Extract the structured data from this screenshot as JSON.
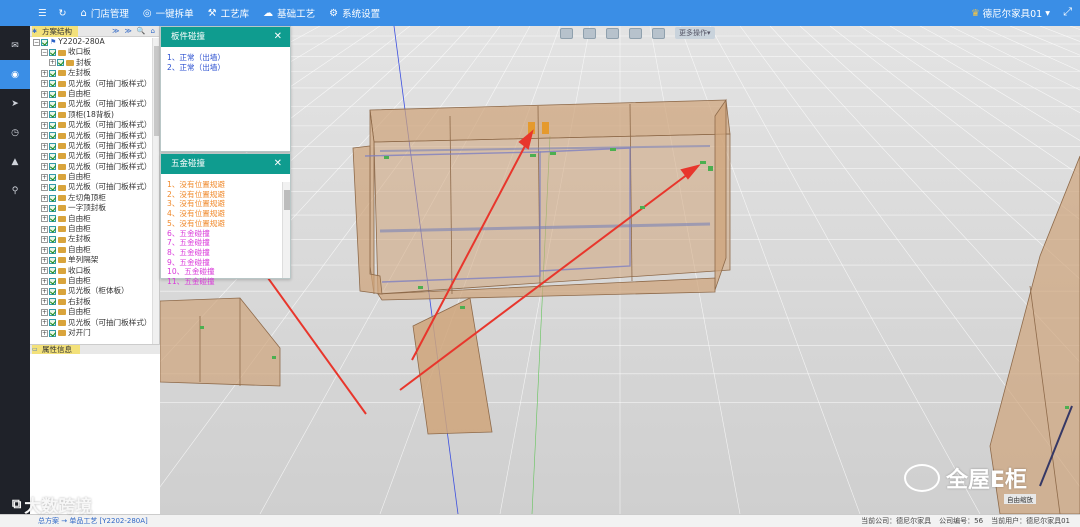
{
  "topbar": {
    "menu_icon": "menu-icon",
    "refresh_icon": "refresh-icon",
    "items": [
      {
        "label": "门店管理",
        "icon": "home-icon"
      },
      {
        "label": "一键拆单",
        "icon": "check-circle-icon"
      },
      {
        "label": "工艺库",
        "icon": "hammer-icon"
      },
      {
        "label": "基础工艺",
        "icon": "cloud-icon"
      },
      {
        "label": "系统设置",
        "icon": "gear-icon"
      }
    ],
    "brand": "德尼尔家具01",
    "brand_caret": "▾"
  },
  "rail": {
    "icons": [
      "mail-icon",
      "wifi-icon",
      "send-icon",
      "clock-icon",
      "hat-icon",
      "search-icon"
    ],
    "active_index": 1
  },
  "tree": {
    "tab_label": "方案结构",
    "tools": [
      "≫",
      "≫",
      "🔍",
      "⌂"
    ],
    "items": [
      {
        "label": "Y2202-280A",
        "level": 0,
        "toggle": "−"
      },
      {
        "label": "收口板",
        "level": 1,
        "toggle": "−"
      },
      {
        "label": "封板",
        "level": 2,
        "toggle": "+"
      },
      {
        "label": "左封板",
        "level": 1,
        "toggle": "+"
      },
      {
        "label": "见光板（可抽门板样式）",
        "level": 1,
        "toggle": "+"
      },
      {
        "label": "自由柜",
        "level": 1,
        "toggle": "+"
      },
      {
        "label": "见光板（可抽门板样式）",
        "level": 1,
        "toggle": "+"
      },
      {
        "label": "顶柜(18背板)",
        "level": 1,
        "toggle": "+"
      },
      {
        "label": "见光板（可抽门板样式）",
        "level": 1,
        "toggle": "+"
      },
      {
        "label": "见光板（可抽门板样式）",
        "level": 1,
        "toggle": "+"
      },
      {
        "label": "见光板（可抽门板样式）",
        "level": 1,
        "toggle": "+"
      },
      {
        "label": "见光板（可抽门板样式）",
        "level": 1,
        "toggle": "+"
      },
      {
        "label": "见光板（可抽门板样式）",
        "level": 1,
        "toggle": "+"
      },
      {
        "label": "自由柜",
        "level": 1,
        "toggle": "+"
      },
      {
        "label": "见光板（可抽门板样式）",
        "level": 1,
        "toggle": "+"
      },
      {
        "label": "左切角顶柜",
        "level": 1,
        "toggle": "+"
      },
      {
        "label": "一字顶封板",
        "level": 1,
        "toggle": "+"
      },
      {
        "label": "自由柜",
        "level": 1,
        "toggle": "+"
      },
      {
        "label": "自由柜",
        "level": 1,
        "toggle": "+"
      },
      {
        "label": "左封板",
        "level": 1,
        "toggle": "+"
      },
      {
        "label": "自由柜",
        "level": 1,
        "toggle": "+"
      },
      {
        "label": "单列隔架",
        "level": 1,
        "toggle": "+"
      },
      {
        "label": "收口板",
        "level": 1,
        "toggle": "+"
      },
      {
        "label": "自由柜",
        "level": 1,
        "toggle": "+"
      },
      {
        "label": "见光板（柜体板）",
        "level": 1,
        "toggle": "+"
      },
      {
        "label": "右封板",
        "level": 1,
        "toggle": "+"
      },
      {
        "label": "自由柜",
        "level": 1,
        "toggle": "+"
      },
      {
        "label": "见光板（可抽门板样式）",
        "level": 1,
        "toggle": "+"
      },
      {
        "label": "对开门",
        "level": 1,
        "toggle": "+"
      }
    ]
  },
  "property": {
    "tab_label": "属性信息"
  },
  "panel_plate": {
    "title": "板件碰撞",
    "close": "✕",
    "items": [
      {
        "text": "1、正常（出墙）",
        "color": "#2a4fd0"
      },
      {
        "text": "2、正常（出墙）",
        "color": "#2a4fd0"
      }
    ]
  },
  "panel_hardware": {
    "title": "五金碰撞",
    "close": "✕",
    "items": [
      {
        "text": "1、没有位置规避",
        "color": "#f0892a"
      },
      {
        "text": "2、没有位置规避",
        "color": "#f0892a"
      },
      {
        "text": "3、没有位置规避",
        "color": "#f0892a"
      },
      {
        "text": "4、没有位置规避",
        "color": "#f0892a"
      },
      {
        "text": "5、没有位置规避",
        "color": "#f0892a"
      },
      {
        "text": "6、五金碰撞",
        "color": "#d93ad9"
      },
      {
        "text": "7、五金碰撞",
        "color": "#d93ad9"
      },
      {
        "text": "8、五金碰撞",
        "color": "#d93ad9"
      },
      {
        "text": "9、五金碰撞",
        "color": "#d93ad9"
      },
      {
        "text": "10、五金碰撞",
        "color": "#d93ad9"
      },
      {
        "text": "11、五金碰撞",
        "color": "#d93ad9"
      }
    ]
  },
  "viewport_toolbar": {
    "icons": [
      "save-icon",
      "target-icon",
      "layers-icon",
      "fullscreen-icon",
      "lightning-icon"
    ],
    "more_label": "更多操作▾"
  },
  "status": {
    "left": "总方案 → 单品工艺 [Y2202-280A]",
    "company": "当前公司：德尼尔家具",
    "company_code": "公司编号：56",
    "user": "当前用户：德尼尔家具01"
  },
  "autoscale_label": "自由缩放",
  "watermark_left": "大数跨境",
  "watermark_right": "全屋E柜",
  "colors": {
    "accent": "#3a8ee6",
    "panel_header": "#0f9c8f",
    "rail": "#1f2229",
    "wood": "#cfa47a",
    "arrow": "#e8362c"
  }
}
